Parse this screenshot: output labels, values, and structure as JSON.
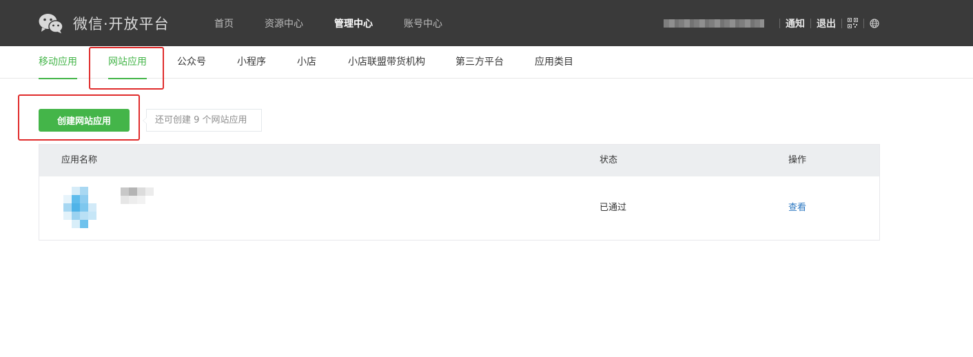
{
  "header": {
    "logo_text": "微信·开放平台",
    "nav": [
      {
        "label": "首页",
        "active": false
      },
      {
        "label": "资源中心",
        "active": false
      },
      {
        "label": "管理中心",
        "active": true
      },
      {
        "label": "账号中心",
        "active": false
      }
    ],
    "notify": "通知",
    "logout": "退出",
    "icons": [
      "qrcode-icon",
      "globe-icon"
    ]
  },
  "subnav": {
    "items": [
      {
        "label": "移动应用",
        "active": true
      },
      {
        "label": "网站应用",
        "active": true
      },
      {
        "label": "公众号",
        "active": false
      },
      {
        "label": "小程序",
        "active": false
      },
      {
        "label": "小店",
        "active": false
      },
      {
        "label": "小店联盟带货机构",
        "active": false
      },
      {
        "label": "第三方平台",
        "active": false
      },
      {
        "label": "应用类目",
        "active": false
      }
    ]
  },
  "actions": {
    "create_label": "创建网站应用",
    "remaining_tip": "还可创建 9 个网站应用"
  },
  "table": {
    "columns": [
      "应用名称",
      "状态",
      "操作"
    ],
    "rows": [
      {
        "status": "已通过",
        "action": "查看"
      }
    ]
  },
  "colors": {
    "header_bg": "#3a3a3a",
    "accent_green": "#44b549",
    "link_blue": "#2b77c1",
    "annotation_red": "#e02b2b",
    "table_header_bg": "#eceef0"
  }
}
